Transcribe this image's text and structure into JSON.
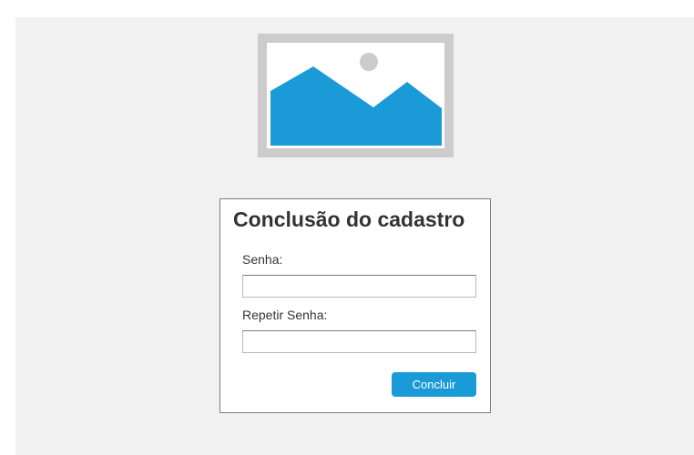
{
  "logo": {
    "icon": "image-placeholder-icon",
    "frame_color": "#cccccc",
    "mountain_color": "#1a9ad6",
    "sun_color": "#cccccc"
  },
  "form": {
    "title": "Conclusão do cadastro",
    "password_label": "Senha:",
    "password_value": "",
    "repeat_password_label": "Repetir Senha:",
    "repeat_password_value": "",
    "submit_label": "Concluir",
    "accent_color": "#1a9ad6"
  }
}
